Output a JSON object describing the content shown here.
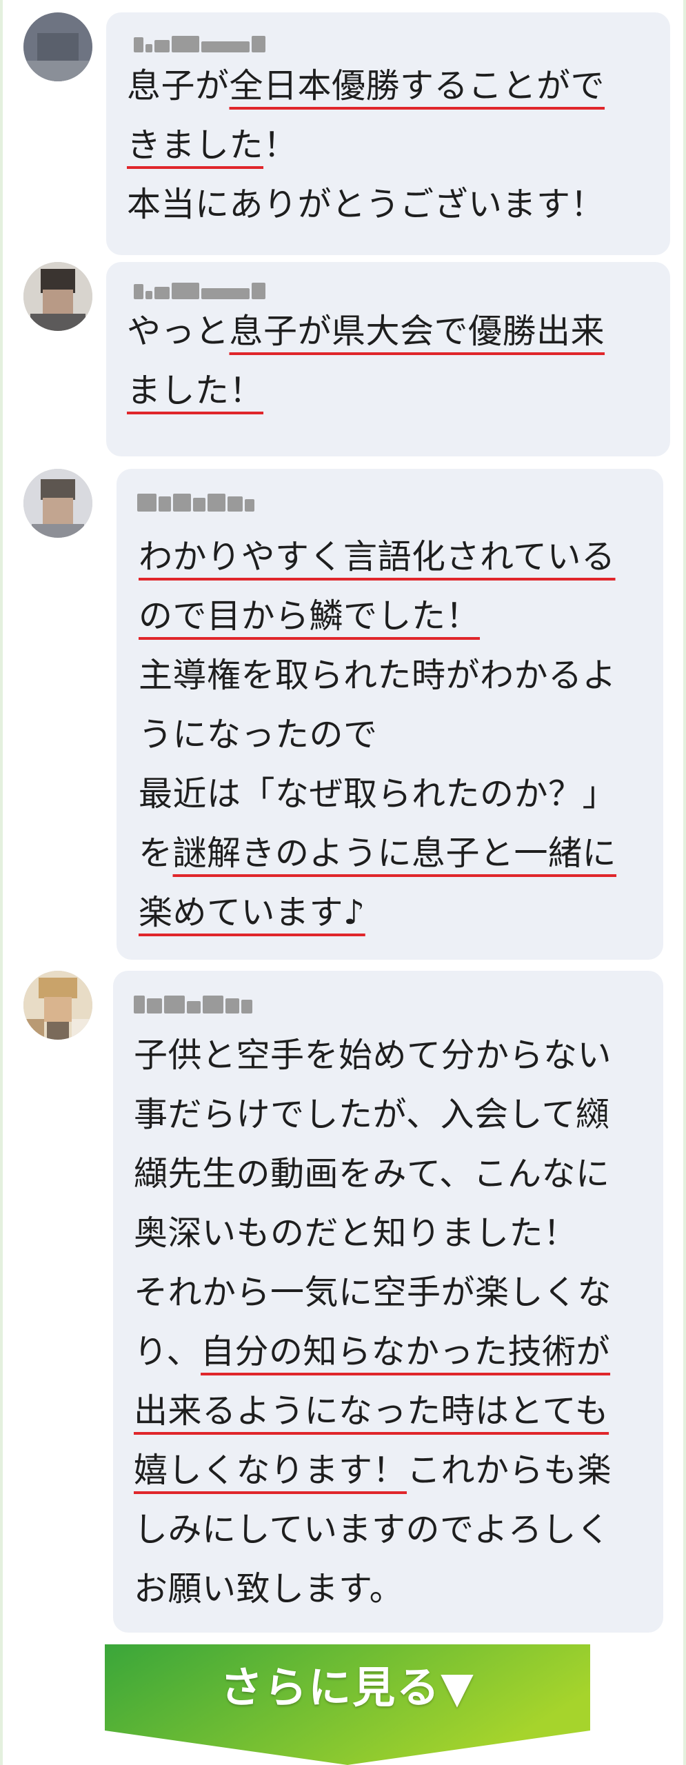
{
  "reviews": [
    {
      "lines": [
        [
          {
            "t": "息子が",
            "u": false
          },
          {
            "t": "全日本優勝することがで",
            "u": true
          }
        ],
        [
          {
            "t": "きました",
            "u": true
          },
          {
            "t": "！",
            "u": false
          }
        ],
        [
          {
            "t": "本当にありがとうございます！",
            "u": false
          }
        ]
      ]
    },
    {
      "lines": [
        [
          {
            "t": "やっと",
            "u": false
          },
          {
            "t": "息子が県大会で優勝出来",
            "u": true
          }
        ],
        [
          {
            "t": "ました！",
            "u": true
          }
        ]
      ]
    },
    {
      "lines": [
        [
          {
            "t": "わかりやすく言語化されている",
            "u": true
          }
        ],
        [
          {
            "t": "ので目から鱗でした！",
            "u": true
          }
        ],
        [
          {
            "t": "主導権を取られた時がわかるよ",
            "u": false
          }
        ],
        [
          {
            "t": "うになったので",
            "u": false
          }
        ],
        [
          {
            "t": "最近は「なぜ取られたのか？」",
            "u": false
          }
        ],
        [
          {
            "t": "を",
            "u": false
          },
          {
            "t": "謎解きのように息子と一緒に",
            "u": true
          }
        ],
        [
          {
            "t": "楽めています♪",
            "u": true
          }
        ]
      ]
    },
    {
      "lines": [
        [
          {
            "t": "子供と空手を始めて分からない",
            "u": false
          }
        ],
        [
          {
            "t": "事だらけでしたが、入会して纐",
            "u": false
          }
        ],
        [
          {
            "t": "纈先生の動画をみて、こんなに",
            "u": false
          }
        ],
        [
          {
            "t": "奥深いものだと知りました！",
            "u": false
          }
        ],
        [
          {
            "t": "それから一気に空手が楽しくな",
            "u": false
          }
        ],
        [
          {
            "t": "り、",
            "u": false
          },
          {
            "t": "自分の知らなかった技術が",
            "u": true
          }
        ],
        [
          {
            "t": "出来るようになった時はとても",
            "u": true
          }
        ],
        [
          {
            "t": "嬉しくなります！",
            "u": true
          },
          {
            "t": "これからも楽",
            "u": false
          }
        ],
        [
          {
            "t": "しみにしていますのでよろしく",
            "u": false
          }
        ],
        [
          {
            "t": "お願い致します。",
            "u": false
          }
        ]
      ]
    }
  ],
  "more_button": {
    "label": "さらに見る▼",
    "color_top": "#3aa63a",
    "color_bottom": "#a6d42c"
  }
}
